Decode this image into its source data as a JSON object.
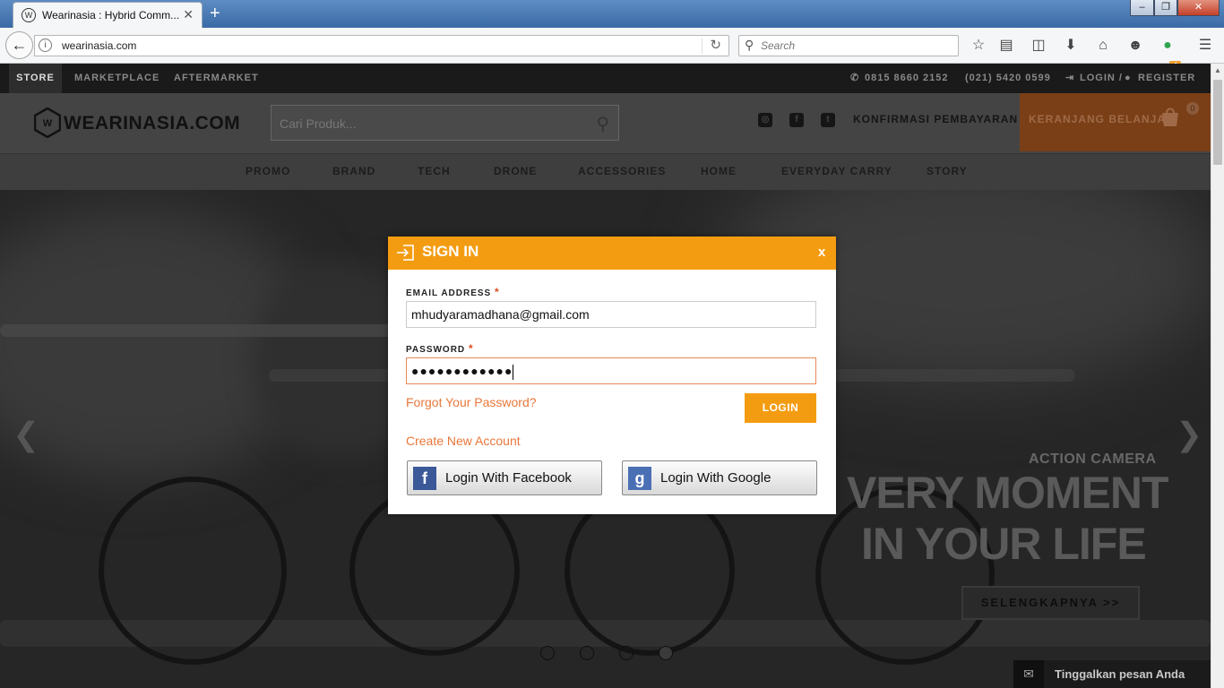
{
  "browser": {
    "tab_title": "Wearinasia : Hybrid Comm...",
    "tab_close": "✕",
    "new_tab": "+",
    "url": "wearinasia.com",
    "search_placeholder": "Search",
    "extension_badge": "4",
    "window_controls": [
      "–",
      "❐",
      "✕"
    ]
  },
  "site": {
    "top_nav": [
      "STORE",
      "MARKETPLACE",
      "AFTERMARKET"
    ],
    "phone_1": "0815 8660 2152",
    "phone_2": "(021) 5420 0599",
    "login": "LOGIN /",
    "register": "REGISTER",
    "logo_text": "WEARINASIA.COM",
    "product_search_placeholder": "Cari Produk...",
    "konfirmasi": "KONFIRMASI PEMBAYARAN",
    "cart_label": "KERANJANG BELANJA",
    "cart_count": "0",
    "categories": [
      "PROMO",
      "BRAND",
      "TECH",
      "DRONE",
      "ACCESSORIES",
      "HOME",
      "EVERYDAY CARRY",
      "STORY"
    ]
  },
  "hero": {
    "subtitle": "ACTION CAMERA",
    "line1": "VERY MOMENT",
    "line2": "IN YOUR LIFE",
    "button": "SELENGKAPNYA >>",
    "prev": "❮",
    "next": "❯",
    "slide_count": 4,
    "active_slide": 4
  },
  "livechat": {
    "label": "Tinggalkan pesan Anda"
  },
  "modal": {
    "title": "SIGN IN",
    "close": "x",
    "email_label": "EMAIL ADDRESS",
    "password_label": "PASSWORD",
    "required_mark": "*",
    "email_value": "mhudyaramadhana@gmail.com",
    "password_mask": "●●●●●●●●●●●●",
    "forgot": "Forgot Your Password?",
    "login_button": "LOGIN",
    "create_account": "Create New Account",
    "facebook_button": "Login With Facebook",
    "google_button": "Login With Google"
  },
  "colors": {
    "accent": "#f39c12",
    "link": "#e9773a",
    "facebook": "#3b5998",
    "google": "#4a6fb5"
  }
}
